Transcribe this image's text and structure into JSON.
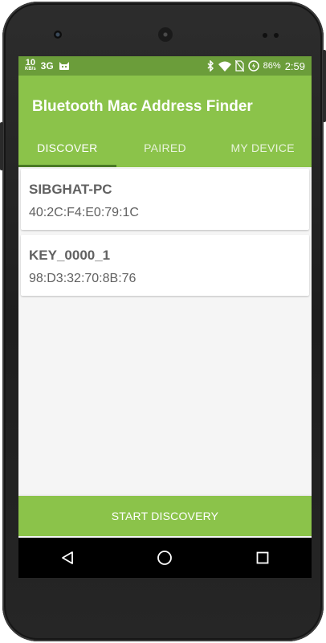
{
  "status_bar": {
    "speed_value": "10",
    "speed_unit": "KB/s",
    "network": "3G",
    "battery": "86%",
    "time": "2:59",
    "icons": [
      "cat-icon",
      "bluetooth-icon",
      "wifi-icon",
      "no-sim-icon",
      "battery-icon"
    ]
  },
  "app": {
    "title": "Bluetooth Mac Address Finder",
    "accent_color": "#8bc34a",
    "status_color": "#6b9d3a"
  },
  "tabs": [
    {
      "label": "DISCOVER",
      "active": true
    },
    {
      "label": "PAIRED",
      "active": false
    },
    {
      "label": "MY DEVICE",
      "active": false
    }
  ],
  "devices": [
    {
      "name": "SIBGHAT-PC",
      "mac": "40:2C:F4:E0:79:1C"
    },
    {
      "name": "KEY_0000_1",
      "mac": "98:D3:32:70:8B:76"
    }
  ],
  "start_button": {
    "label": "START DISCOVERY"
  },
  "nav": {
    "icons": [
      "back-icon",
      "home-icon",
      "recents-icon"
    ]
  }
}
